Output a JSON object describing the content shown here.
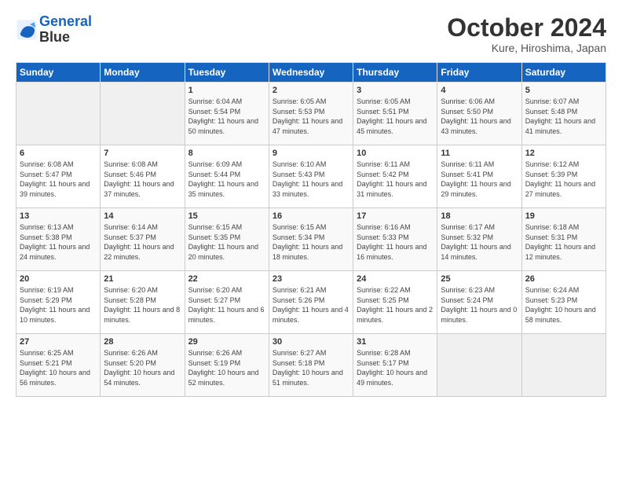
{
  "logo": {
    "line1": "General",
    "line2": "Blue"
  },
  "calendar": {
    "title": "October 2024",
    "subtitle": "Kure, Hiroshima, Japan"
  },
  "headers": [
    "Sunday",
    "Monday",
    "Tuesday",
    "Wednesday",
    "Thursday",
    "Friday",
    "Saturday"
  ],
  "weeks": [
    [
      {
        "day": "",
        "info": ""
      },
      {
        "day": "",
        "info": ""
      },
      {
        "day": "1",
        "info": "Sunrise: 6:04 AM\nSunset: 5:54 PM\nDaylight: 11 hours and 50 minutes."
      },
      {
        "day": "2",
        "info": "Sunrise: 6:05 AM\nSunset: 5:53 PM\nDaylight: 11 hours and 47 minutes."
      },
      {
        "day": "3",
        "info": "Sunrise: 6:05 AM\nSunset: 5:51 PM\nDaylight: 11 hours and 45 minutes."
      },
      {
        "day": "4",
        "info": "Sunrise: 6:06 AM\nSunset: 5:50 PM\nDaylight: 11 hours and 43 minutes."
      },
      {
        "day": "5",
        "info": "Sunrise: 6:07 AM\nSunset: 5:48 PM\nDaylight: 11 hours and 41 minutes."
      }
    ],
    [
      {
        "day": "6",
        "info": "Sunrise: 6:08 AM\nSunset: 5:47 PM\nDaylight: 11 hours and 39 minutes."
      },
      {
        "day": "7",
        "info": "Sunrise: 6:08 AM\nSunset: 5:46 PM\nDaylight: 11 hours and 37 minutes."
      },
      {
        "day": "8",
        "info": "Sunrise: 6:09 AM\nSunset: 5:44 PM\nDaylight: 11 hours and 35 minutes."
      },
      {
        "day": "9",
        "info": "Sunrise: 6:10 AM\nSunset: 5:43 PM\nDaylight: 11 hours and 33 minutes."
      },
      {
        "day": "10",
        "info": "Sunrise: 6:11 AM\nSunset: 5:42 PM\nDaylight: 11 hours and 31 minutes."
      },
      {
        "day": "11",
        "info": "Sunrise: 6:11 AM\nSunset: 5:41 PM\nDaylight: 11 hours and 29 minutes."
      },
      {
        "day": "12",
        "info": "Sunrise: 6:12 AM\nSunset: 5:39 PM\nDaylight: 11 hours and 27 minutes."
      }
    ],
    [
      {
        "day": "13",
        "info": "Sunrise: 6:13 AM\nSunset: 5:38 PM\nDaylight: 11 hours and 24 minutes."
      },
      {
        "day": "14",
        "info": "Sunrise: 6:14 AM\nSunset: 5:37 PM\nDaylight: 11 hours and 22 minutes."
      },
      {
        "day": "15",
        "info": "Sunrise: 6:15 AM\nSunset: 5:35 PM\nDaylight: 11 hours and 20 minutes."
      },
      {
        "day": "16",
        "info": "Sunrise: 6:15 AM\nSunset: 5:34 PM\nDaylight: 11 hours and 18 minutes."
      },
      {
        "day": "17",
        "info": "Sunrise: 6:16 AM\nSunset: 5:33 PM\nDaylight: 11 hours and 16 minutes."
      },
      {
        "day": "18",
        "info": "Sunrise: 6:17 AM\nSunset: 5:32 PM\nDaylight: 11 hours and 14 minutes."
      },
      {
        "day": "19",
        "info": "Sunrise: 6:18 AM\nSunset: 5:31 PM\nDaylight: 11 hours and 12 minutes."
      }
    ],
    [
      {
        "day": "20",
        "info": "Sunrise: 6:19 AM\nSunset: 5:29 PM\nDaylight: 11 hours and 10 minutes."
      },
      {
        "day": "21",
        "info": "Sunrise: 6:20 AM\nSunset: 5:28 PM\nDaylight: 11 hours and 8 minutes."
      },
      {
        "day": "22",
        "info": "Sunrise: 6:20 AM\nSunset: 5:27 PM\nDaylight: 11 hours and 6 minutes."
      },
      {
        "day": "23",
        "info": "Sunrise: 6:21 AM\nSunset: 5:26 PM\nDaylight: 11 hours and 4 minutes."
      },
      {
        "day": "24",
        "info": "Sunrise: 6:22 AM\nSunset: 5:25 PM\nDaylight: 11 hours and 2 minutes."
      },
      {
        "day": "25",
        "info": "Sunrise: 6:23 AM\nSunset: 5:24 PM\nDaylight: 11 hours and 0 minutes."
      },
      {
        "day": "26",
        "info": "Sunrise: 6:24 AM\nSunset: 5:23 PM\nDaylight: 10 hours and 58 minutes."
      }
    ],
    [
      {
        "day": "27",
        "info": "Sunrise: 6:25 AM\nSunset: 5:21 PM\nDaylight: 10 hours and 56 minutes."
      },
      {
        "day": "28",
        "info": "Sunrise: 6:26 AM\nSunset: 5:20 PM\nDaylight: 10 hours and 54 minutes."
      },
      {
        "day": "29",
        "info": "Sunrise: 6:26 AM\nSunset: 5:19 PM\nDaylight: 10 hours and 52 minutes."
      },
      {
        "day": "30",
        "info": "Sunrise: 6:27 AM\nSunset: 5:18 PM\nDaylight: 10 hours and 51 minutes."
      },
      {
        "day": "31",
        "info": "Sunrise: 6:28 AM\nSunset: 5:17 PM\nDaylight: 10 hours and 49 minutes."
      },
      {
        "day": "",
        "info": ""
      },
      {
        "day": "",
        "info": ""
      }
    ]
  ]
}
